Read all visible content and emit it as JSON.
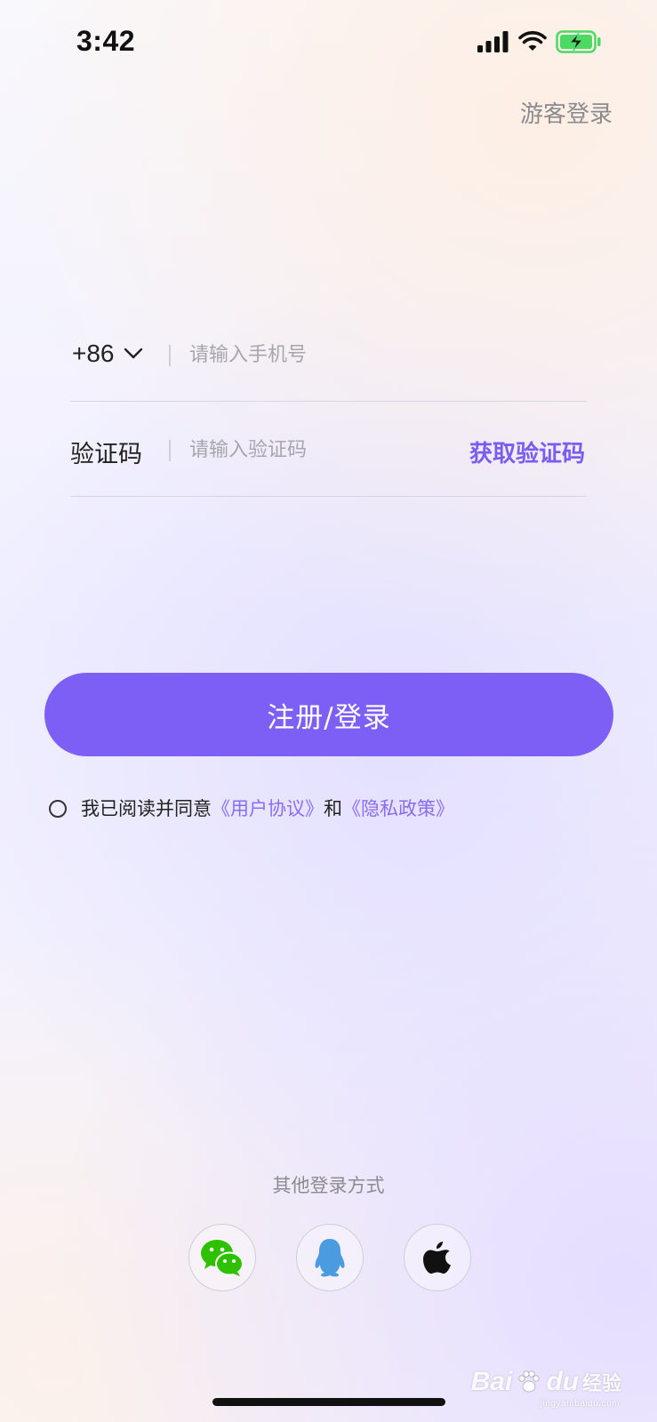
{
  "status_bar": {
    "time": "3:42",
    "icons": [
      "signal-icon",
      "wifi-icon",
      "battery-charging-icon"
    ],
    "battery_color": "#4cd964"
  },
  "header": {
    "guest_login": "游客登录"
  },
  "phone_row": {
    "country_code": "+86",
    "placeholder": "请输入手机号",
    "value": ""
  },
  "code_row": {
    "label": "验证码",
    "placeholder": "请输入验证码",
    "value": "",
    "get_code": "获取验证码"
  },
  "login_button": {
    "label": "注册/登录"
  },
  "agreement": {
    "prefix": "我已阅读并同意",
    "user_agreement": "《用户协议》",
    "conjunction": "和",
    "privacy_policy": "《隐私政策》",
    "checked": false
  },
  "other_login": {
    "title": "其他登录方式",
    "methods": [
      "wechat-icon",
      "qq-icon",
      "apple-icon"
    ]
  },
  "watermark": {
    "text": "Bai",
    "text2": "du",
    "cn": "经验",
    "sub": "jingyan.baidu.com"
  },
  "colors": {
    "accent": "#7d5ff5",
    "link": "#8a6cf0",
    "wechat": "#2dc100",
    "qq": "#4a9be0"
  }
}
